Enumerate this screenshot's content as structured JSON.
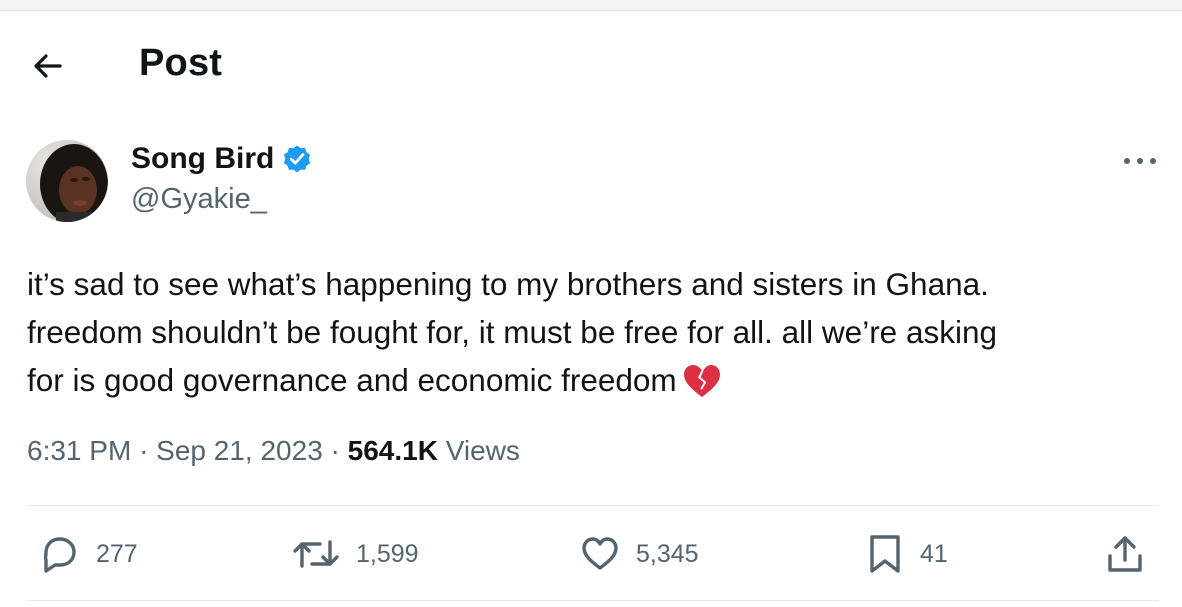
{
  "header": {
    "title": "Post",
    "back_icon": "arrow-left-icon"
  },
  "author": {
    "name": "Song Bird",
    "handle": "@Gyakie_",
    "verified": true,
    "verified_color": "#1d9bf0"
  },
  "post": {
    "lines": [
      "it’s sad to see what’s happening to my brothers and sisters in Ghana.",
      "freedom shouldn’t be fought for, it must be free for all. all we’re asking",
      "for is good governance and economic freedom"
    ],
    "emoji": "broken-heart-icon",
    "time": "6:31 PM",
    "date": "Sep 21, 2023",
    "views_count": "564.1K",
    "views_label": "Views",
    "separator": "·"
  },
  "actions": {
    "replies": "277",
    "reposts": "1,599",
    "likes": "5,345",
    "bookmarks": "41"
  },
  "colors": {
    "text": "#0f1419",
    "secondary": "#536471",
    "divider": "#e6e9eb",
    "emoji": "#dd2e44"
  }
}
